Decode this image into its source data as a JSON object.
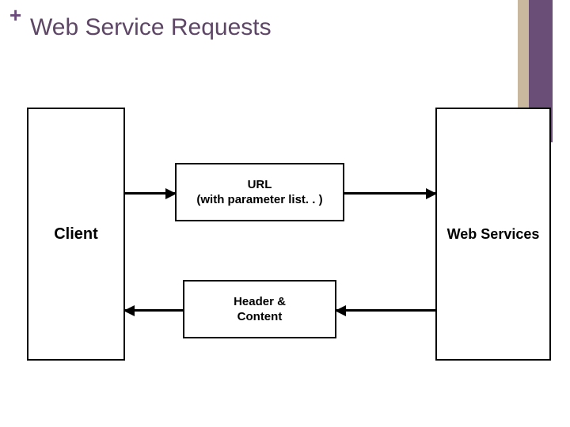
{
  "header": {
    "plus": "+",
    "title": "Web Service Requests"
  },
  "boxes": {
    "client": "Client",
    "webservices": "Web Services",
    "url_line1": "URL",
    "url_line2": "(with parameter list. . )",
    "resp_line1": "Header &",
    "resp_line2": "Content"
  }
}
